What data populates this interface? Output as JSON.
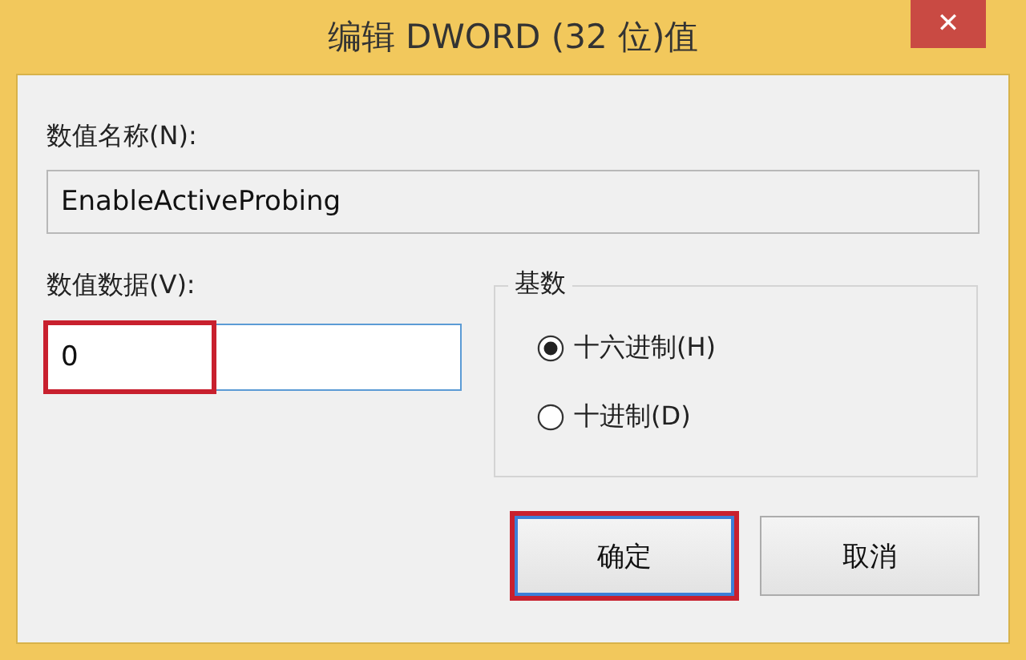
{
  "window": {
    "title": "编辑 DWORD (32 位)值",
    "close": "✕"
  },
  "value_name": {
    "label": "数值名称(N):",
    "value": "EnableActiveProbing"
  },
  "value_data": {
    "label": "数值数据(V):",
    "value": "0",
    "highlighted": true
  },
  "base": {
    "title": "基数",
    "options": [
      {
        "label": "十六进制(H)",
        "selected": true
      },
      {
        "label": "十进制(D)",
        "selected": false
      }
    ]
  },
  "buttons": [
    {
      "label": "确定",
      "default": true,
      "highlighted": true
    },
    {
      "label": "取消",
      "default": false,
      "highlighted": false
    }
  ]
}
